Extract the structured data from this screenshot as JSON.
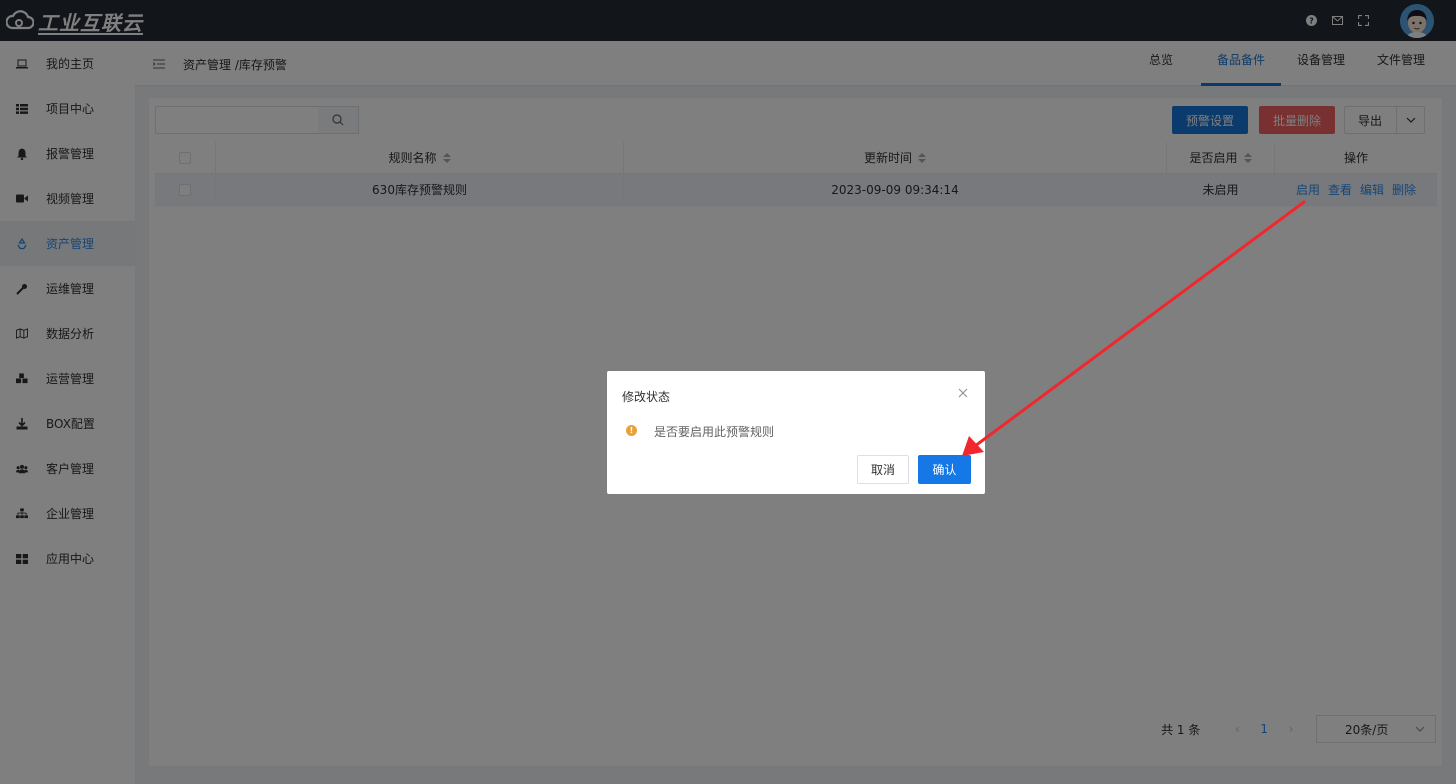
{
  "app": {
    "logo_text": "工业互联云"
  },
  "sidebar": {
    "items": [
      {
        "label": "我的主页",
        "icon": "laptop-icon"
      },
      {
        "label": "项目中心",
        "icon": "list-icon"
      },
      {
        "label": "报警管理",
        "icon": "bell-icon"
      },
      {
        "label": "视频管理",
        "icon": "video-icon"
      },
      {
        "label": "资产管理",
        "icon": "recycle-icon"
      },
      {
        "label": "运维管理",
        "icon": "wrench-icon"
      },
      {
        "label": "数据分析",
        "icon": "map-icon"
      },
      {
        "label": "运营管理",
        "icon": "cubes-icon"
      },
      {
        "label": "BOX配置",
        "icon": "download-icon"
      },
      {
        "label": "客户管理",
        "icon": "users-icon"
      },
      {
        "label": "企业管理",
        "icon": "sitemap-icon"
      },
      {
        "label": "应用中心",
        "icon": "grid-icon"
      }
    ],
    "active_index": 4
  },
  "header": {
    "breadcrumb": "资产管理 /库存预警",
    "tabs": [
      "总览",
      "备品备件",
      "设备管理",
      "文件管理"
    ],
    "active_tab": 1
  },
  "toolbar": {
    "search_placeholder": "",
    "warn_settings": "预警设置",
    "batch_delete": "批量删除",
    "export": "导出"
  },
  "table": {
    "columns": [
      "规则名称",
      "更新时间",
      "是否启用",
      "操作"
    ],
    "rows": [
      {
        "name": "630库存预警规则",
        "updated": "2023-09-09 09:34:14",
        "enabled": "未启用",
        "actions": [
          "启用",
          "查看",
          "编辑",
          "删除"
        ]
      }
    ]
  },
  "pagination": {
    "total": "共 1 条",
    "current_page": "1",
    "page_size": "20条/页"
  },
  "dialog": {
    "title": "修改状态",
    "message": "是否要启用此预警规则",
    "cancel": "取消",
    "confirm": "确认"
  },
  "colors": {
    "accent": "#1976d2",
    "danger": "#f06060",
    "warning": "#e6a23c",
    "annotation_arrow": "#f0282d",
    "header_bg": "#242a35"
  }
}
